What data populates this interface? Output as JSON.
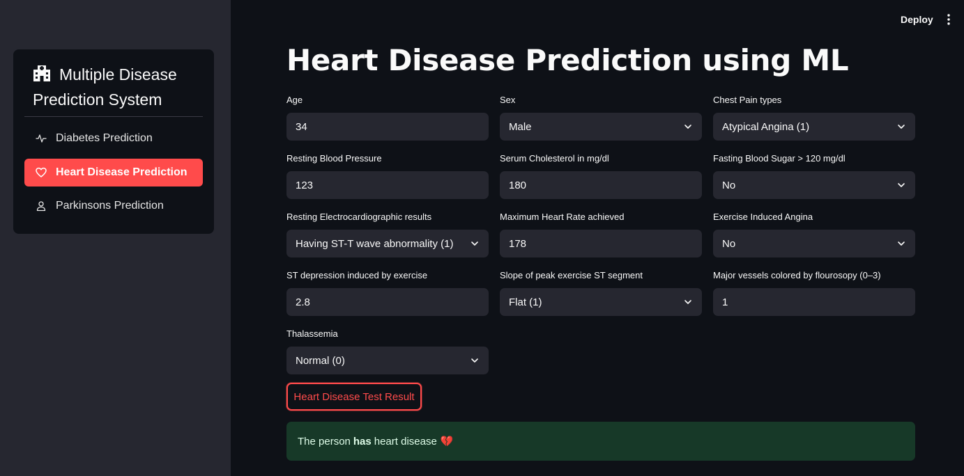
{
  "sidebar": {
    "title": "Multiple Disease Prediction System",
    "title_icon": "hospital-icon",
    "items": [
      {
        "label": "Diabetes Prediction",
        "icon": "activity-icon",
        "active": false
      },
      {
        "label": "Heart Disease Prediction",
        "icon": "heart-icon",
        "active": true
      },
      {
        "label": "Parkinsons Prediction",
        "icon": "person-icon",
        "active": false
      }
    ]
  },
  "header": {
    "deploy_label": "Deploy",
    "menu_icon": "kebab-menu-icon"
  },
  "main": {
    "title": "Heart Disease Prediction using ML",
    "fields": {
      "age": {
        "label": "Age",
        "value": "34",
        "type": "input"
      },
      "sex": {
        "label": "Sex",
        "value": "Male",
        "type": "select"
      },
      "chest_pain": {
        "label": "Chest Pain types",
        "value": "Atypical Angina (1)",
        "type": "select"
      },
      "resting_bp": {
        "label": "Resting Blood Pressure",
        "value": "123",
        "type": "input"
      },
      "cholesterol": {
        "label": "Serum Cholesterol in mg/dl",
        "value": "180",
        "type": "input"
      },
      "fasting_sugar": {
        "label": "Fasting Blood Sugar > 120 mg/dl",
        "value": "No",
        "type": "select"
      },
      "rest_ecg": {
        "label": "Resting Electrocardiographic results",
        "value": "Having ST-T wave abnormality (1)",
        "type": "select"
      },
      "max_hr": {
        "label": "Maximum Heart Rate achieved",
        "value": "178",
        "type": "input"
      },
      "exercise_angina": {
        "label": "Exercise Induced Angina",
        "value": "No",
        "type": "select"
      },
      "st_depression": {
        "label": "ST depression induced by exercise",
        "value": "2.8",
        "type": "input"
      },
      "slope": {
        "label": "Slope of peak exercise ST segment",
        "value": "Flat (1)",
        "type": "select"
      },
      "vessels": {
        "label": "Major vessels colored by flourosopy (0–3)",
        "value": "1",
        "type": "input"
      },
      "thal": {
        "label": "Thalassemia",
        "value": "Normal (0)",
        "type": "select"
      }
    },
    "result_button_label": "Heart Disease Test Result",
    "result": {
      "prefix": "The person",
      "emphasis": "has",
      "suffix": "heart disease",
      "emoji": "💔"
    }
  },
  "colors": {
    "accent": "#ff4b4b",
    "background": "#0e1117",
    "sidebar": "#262730",
    "success_bg": "#173928"
  }
}
